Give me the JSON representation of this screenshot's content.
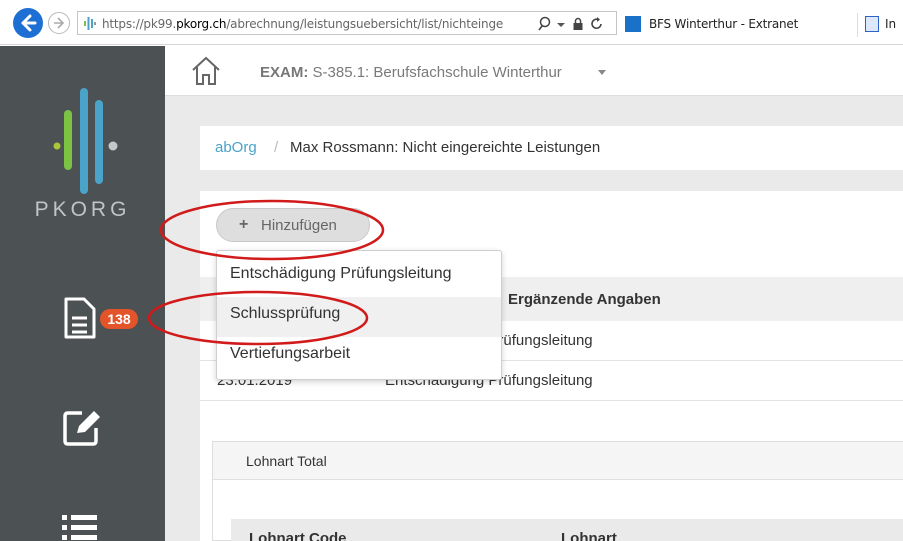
{
  "browser": {
    "url_prefix": "https://pk99.",
    "url_domain": "pkorg.ch",
    "url_path": "/abrechnung/leistungsuebersicht/list/nichteinge",
    "active_tab_title": "BFS Winterthur - Extranet",
    "next_tab_title": "In"
  },
  "sidebar": {
    "logo_text": "PKORG",
    "badge_count": "138"
  },
  "header": {
    "exam_label": "EXAM:",
    "exam_value": "S-385.1: Berufsfachschule Winterthur"
  },
  "breadcrumb": {
    "link": "abOrg",
    "separator": "/",
    "current": "Max Rossmann: Nicht eingereichte Leistungen"
  },
  "toolbar": {
    "add_label": "Hinzufügen"
  },
  "dropdown": {
    "items": [
      "Entschädigung Prüfungsleitung",
      "Schlussprüfung",
      "Vertiefungsarbeit"
    ]
  },
  "table": {
    "col2_header": "Ergänzende Angaben",
    "rows": [
      {
        "date": "",
        "type": "Entschädigung Prüfungsleitung"
      },
      {
        "date": "23.01.2019",
        "type": "Entschädigung Prüfungsleitung"
      }
    ]
  },
  "lohnart": {
    "title": "Lohnart Total",
    "col1": "Lohnart Code",
    "col2": "Lohnart"
  },
  "colors": {
    "sidebar_bg": "#4c5153",
    "badge": "#e4542b",
    "link": "#4aa3c9",
    "annotation": "#d11a1a"
  }
}
